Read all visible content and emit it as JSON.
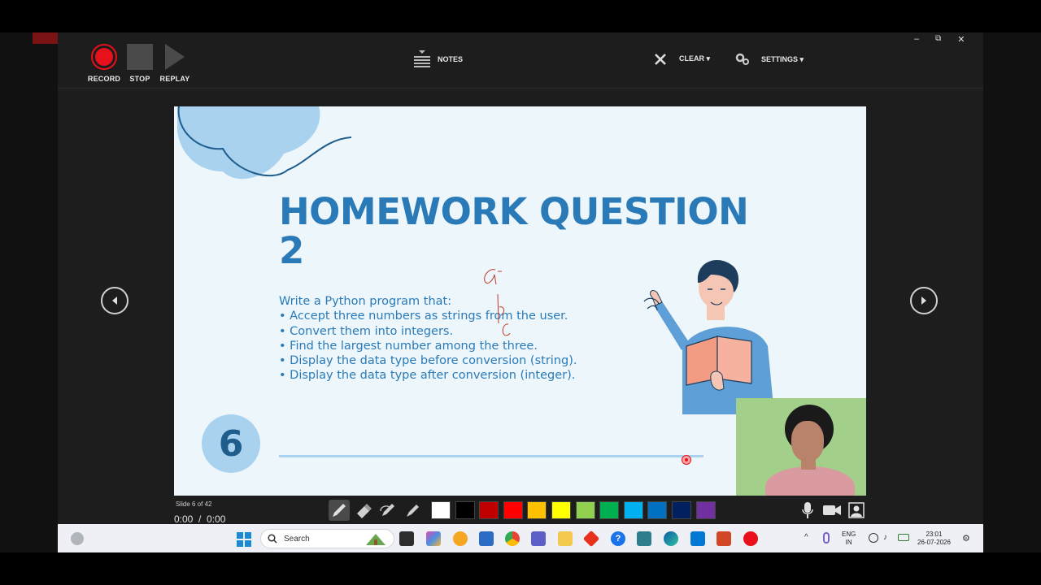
{
  "toolbar": {
    "record_label": "RECORD",
    "stop_label": "STOP",
    "replay_label": "REPLAY",
    "notes_label": "NOTES",
    "clear_label": "CLEAR ▾",
    "settings_label": "SETTINGS ▾"
  },
  "window_controls": {
    "minimize": "–",
    "restore": "⧉",
    "close": "✕"
  },
  "slide": {
    "title_line1": "HOMEWORK QUESTION",
    "title_line2": "2",
    "intro": "Write a Python program that:",
    "bullets": [
      "• Accept three numbers as strings from the user.",
      "• Convert them into integers.",
      "• Find the largest number among the three.",
      "• Display the data type before conversion (string).",
      "• Display the data type after conversion (integer)."
    ],
    "slide_number": "6",
    "annotation_letters": [
      "a",
      "b",
      "c"
    ]
  },
  "player": {
    "slide_counter": "Slide 6 of 42",
    "time": "0:00  /  0:00"
  },
  "palette": {
    "colors": [
      "#ffffff",
      "#000000",
      "#c00000",
      "#ff0000",
      "#ffc000",
      "#ffff00",
      "#92d050",
      "#00b050",
      "#00b0f0",
      "#0070c0",
      "#002060",
      "#7030a0"
    ]
  },
  "taskbar": {
    "search_placeholder": "Search",
    "lang_line1": "ENG",
    "lang_line2": "IN",
    "clock_time": "23:01",
    "clock_date": "26-07-2026"
  },
  "colors": {
    "accent": "#2a7ab8",
    "record_red": "#e8101b"
  }
}
